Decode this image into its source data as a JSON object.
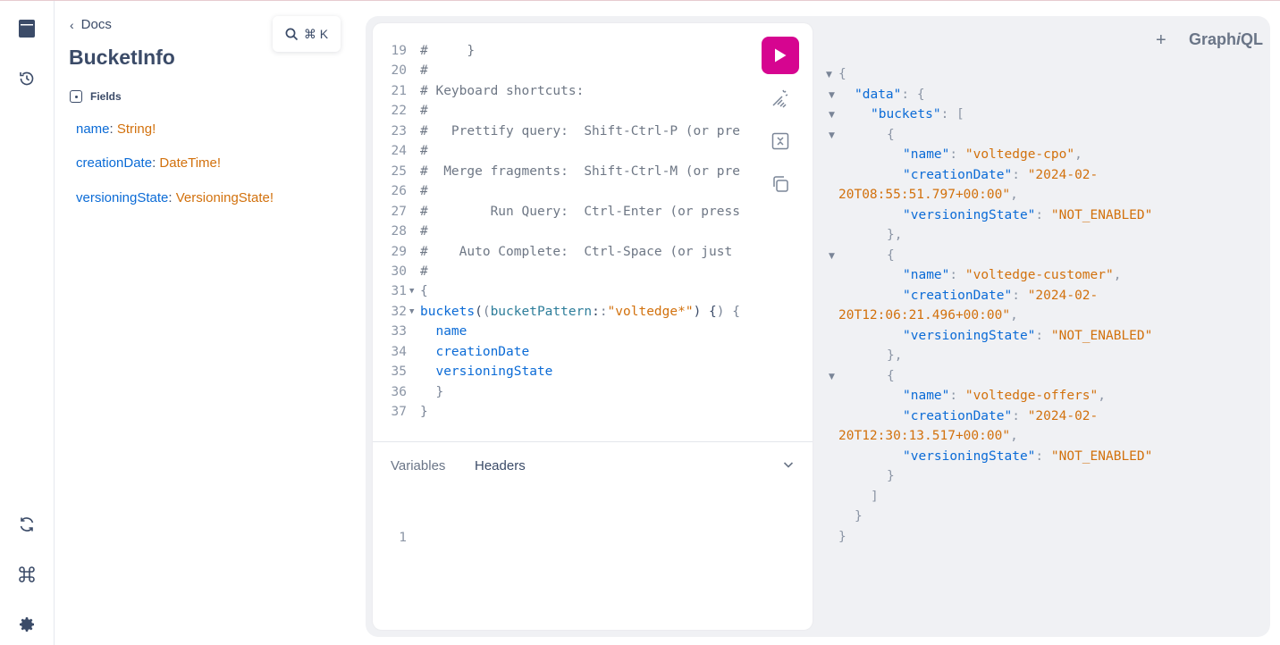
{
  "rail": {
    "icons": [
      "docs-icon",
      "history-icon",
      "refresh-icon",
      "command-icon",
      "settings-icon"
    ]
  },
  "docs": {
    "back_label": "Docs",
    "title": "BucketInfo",
    "fields_heading": "Fields",
    "fields": [
      {
        "name": "name",
        "type": "String",
        "bang": "!"
      },
      {
        "name": "creationDate",
        "type": "DateTime",
        "bang": "!"
      },
      {
        "name": "versioningState",
        "type": "VersioningState",
        "bang": "!"
      }
    ],
    "search_shortcut": "⌘ K"
  },
  "editor": {
    "partial_top": "#     }",
    "lines": [
      {
        "n": "19",
        "text": "#     }"
      },
      {
        "n": "20",
        "text": "#"
      },
      {
        "n": "21",
        "text": "# Keyboard shortcuts:"
      },
      {
        "n": "22",
        "text": "#"
      },
      {
        "n": "23",
        "text": "#   Prettify query:  Shift-Ctrl-P (or pre"
      },
      {
        "n": "24",
        "text": "#"
      },
      {
        "n": "25",
        "text": "#  Merge fragments:  Shift-Ctrl-M (or pre"
      },
      {
        "n": "26",
        "text": "#"
      },
      {
        "n": "27",
        "text": "#        Run Query:  Ctrl-Enter (or press"
      },
      {
        "n": "28",
        "text": "#"
      },
      {
        "n": "29",
        "text": "#    Auto Complete:  Ctrl-Space (or just"
      },
      {
        "n": "30",
        "text": "#"
      }
    ],
    "query": {
      "n31": "31",
      "open": "{",
      "n32": "32",
      "field": "buckets",
      "argname": "bucketPattern",
      "argval": "\"voltedge*\"",
      "n33": "33",
      "f1": "name",
      "n34": "34",
      "f2": "creationDate",
      "n35": "35",
      "f3": "versioningState",
      "n36": "36",
      "close_inner": "}",
      "n37": "37",
      "close_outer": "}"
    }
  },
  "tabs": {
    "variables": "Variables",
    "headers": "Headers",
    "line1": "1"
  },
  "topbar": {
    "plus": "+",
    "brand_a": "Graph",
    "brand_i": "i",
    "brand_b": "QL"
  },
  "result": {
    "buckets": [
      {
        "name": "\"voltedge-cpo\"",
        "date_a": "\"2024-02-",
        "date_b": "20T08:55:51.797+00:00\"",
        "state": "\"NOT_ENABLED\""
      },
      {
        "name": "\"voltedge-customer\"",
        "date_a": "\"2024-02-",
        "date_b": "20T12:06:21.496+00:00\"",
        "state": "\"NOT_ENABLED\""
      },
      {
        "name": "\"voltedge-offers\"",
        "date_a": "\"2024-02-",
        "date_b": "20T12:30:13.517+00:00\"",
        "state": "\"NOT_ENABLED\""
      }
    ],
    "k_data": "\"data\"",
    "k_buckets": "\"buckets\"",
    "k_name": "\"name\"",
    "k_creationDate": "\"creationDate\"",
    "k_versioningState": "\"versioningState\""
  }
}
